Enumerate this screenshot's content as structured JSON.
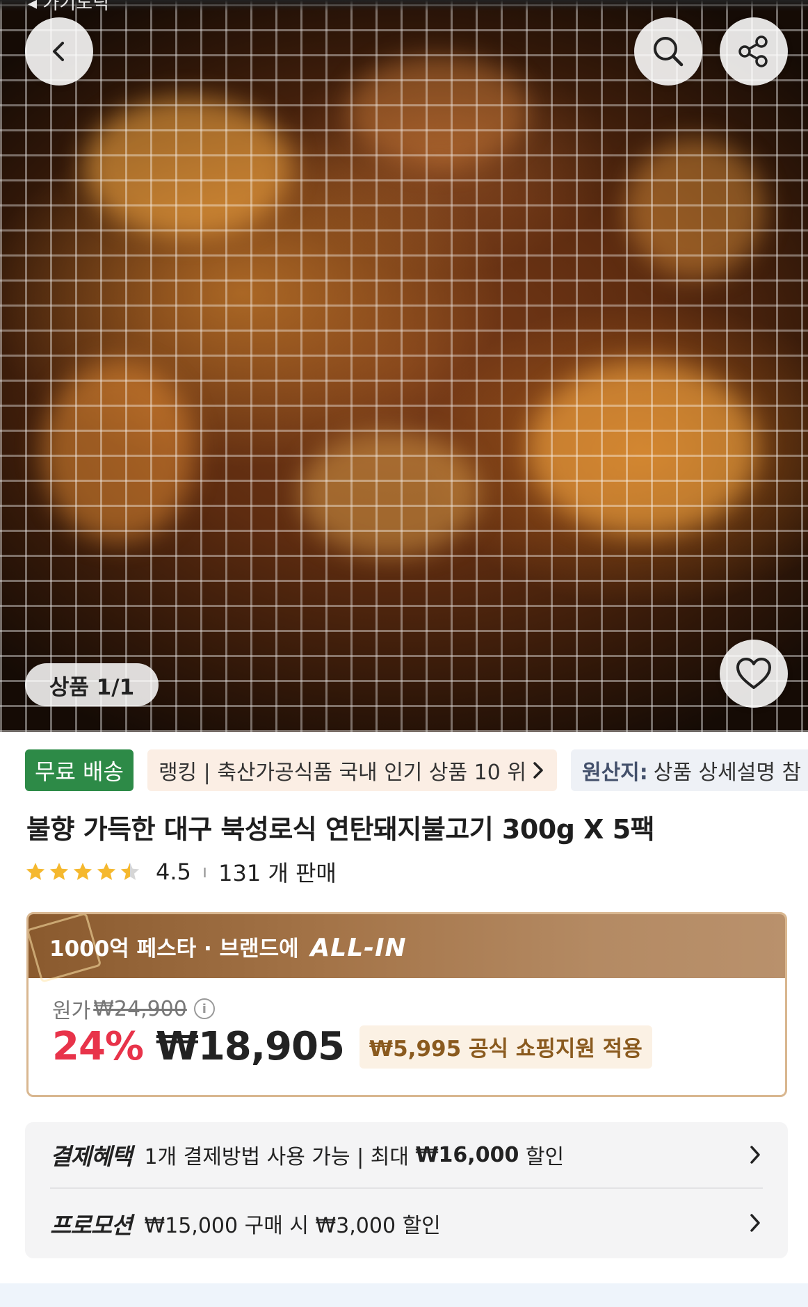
{
  "status_bar": {
    "text": "◂ 가기노딕"
  },
  "hero": {
    "image_counter": "상품 1/1",
    "icons": {
      "back": "back-chevron-icon",
      "search": "search-icon",
      "share": "share-icon",
      "like": "heart-icon"
    }
  },
  "tags": {
    "free_shipping": "무료 배송",
    "ranking": "랭킹 | 축산가공식품 국내 인기 상품 10 위",
    "origin_label": "원산지:",
    "origin_value": "상품 상세설명 참"
  },
  "product": {
    "title": "불향 가득한 대구 북성로식 연탄돼지불고기 300g X 5팩",
    "rating": "4.5",
    "rating_value": 4.5,
    "sales": "131 개 판매"
  },
  "price": {
    "banner_prefix": "1000억 페스타 ·",
    "banner_brand": "브랜드에",
    "banner_allin": "ALL-IN",
    "original_label": "원가",
    "original_price": "₩24,900",
    "discount": "24%",
    "sale_price": "₩18,905",
    "support": "₩5,995 공식 쇼핑지원 적용"
  },
  "benefits": {
    "payment_label": "결제혜택",
    "payment_text_1": "1개 결제방법 사용 가능 | 최대 ",
    "payment_amount": "₩16,000",
    "payment_text_2": " 할인",
    "promo_label": "프로모션",
    "promo_text": "₩15,000 구매 시 ₩3,000 할인"
  },
  "colors": {
    "free_shipping_bg": "#2d8a47",
    "discount": "#e8334a",
    "banner": "#a47448",
    "star": "#f5b82e"
  }
}
